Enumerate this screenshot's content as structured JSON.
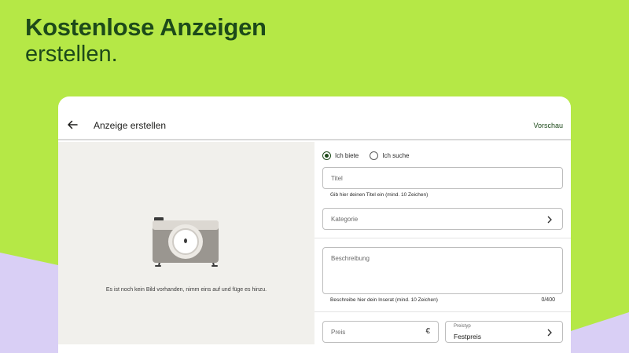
{
  "colors": {
    "brand_green": "#b5e846",
    "dark_green": "#1d4a1a",
    "lilac": "#d9cff5",
    "photo_bg": "#f1f0ec"
  },
  "headline": {
    "line1": "Kostenlose Anzeigen",
    "line2": "erstellen."
  },
  "topbar": {
    "back_icon": "arrow-left-icon",
    "title": "Anzeige erstellen",
    "preview": "Vorschau"
  },
  "photo": {
    "icon": "camera-icon",
    "hint": "Es ist noch kein Bild vorhanden, nimm eins auf und füge es hinzu."
  },
  "form": {
    "offer_type": {
      "options": [
        "Ich biete",
        "Ich suche"
      ],
      "selected": "Ich biete"
    },
    "title": {
      "placeholder": "Titel",
      "helper": "Gib hier deinen Titel ein (mind. 10 Zeichen)"
    },
    "category": {
      "placeholder": "Kategorie",
      "icon": "chevron-right-icon"
    },
    "description": {
      "placeholder": "Beschreibung",
      "helper": "Beschreibe hier dein Inserat (mind. 10 Zeichen)",
      "counter": "0/400"
    },
    "price": {
      "placeholder": "Preis",
      "currency": "€"
    },
    "price_type": {
      "label": "Preistyp",
      "value": "Festpreis",
      "icon": "chevron-right-icon"
    }
  }
}
